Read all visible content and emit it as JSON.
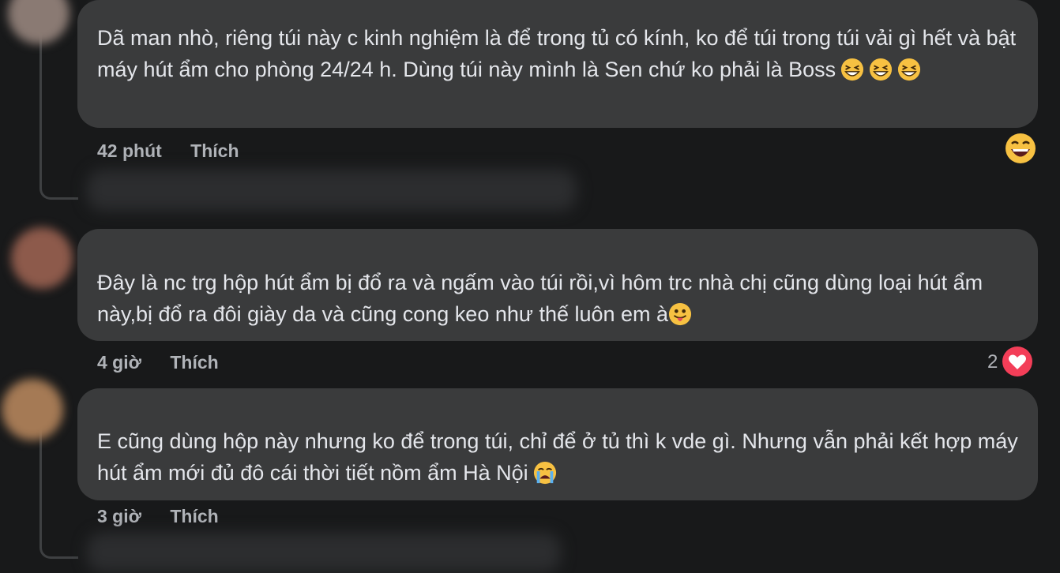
{
  "comments": [
    {
      "text": "Dã man nhò, riêng túi này c kinh nghiệm là để trong tủ có kính, ko để túi trong túi vải gì hết và bật máy hút ẩm cho phòng 24/24 h. Dùng túi này mình là Sen chứ ko phải là Boss",
      "time": "42 phút",
      "like_label": "Thích",
      "emojis": [
        "grinning-squint-icon",
        "grinning-squint-icon",
        "grinning-squint-icon"
      ],
      "reaction_icon": "laughing-reaction-icon"
    },
    {
      "text": "Đây là nc trg hộp hút ẩm bị đổ ra và ngấm vào túi rồi,vì hôm trc nhà chị cũng dùng loại hút ẩm này,bị đổ ra đôi giày da và cũng cong keo như thế luôn em à",
      "time": "4 giờ",
      "like_label": "Thích",
      "emojis": [
        "tongue-out-icon"
      ],
      "reaction_count": "2",
      "reaction_icon": "heart-reaction-icon"
    },
    {
      "text": "E cũng dùng hộp này nhưng ko để trong túi, chỉ để ở tủ thì k vde gì. Nhưng vẫn phải kết hợp máy hút ẩm mới đủ đô cái thời tiết nồm ẩm Hà Nội",
      "time": "3 giờ",
      "like_label": "Thích",
      "emojis": [
        "crying-icon"
      ]
    }
  ],
  "colors": {
    "background": "#18191a",
    "bubble": "#3a3b3c",
    "text": "#e4e6eb",
    "meta": "#b0b3b8",
    "heart": "#f33e58",
    "emoji": "#f7c142"
  }
}
